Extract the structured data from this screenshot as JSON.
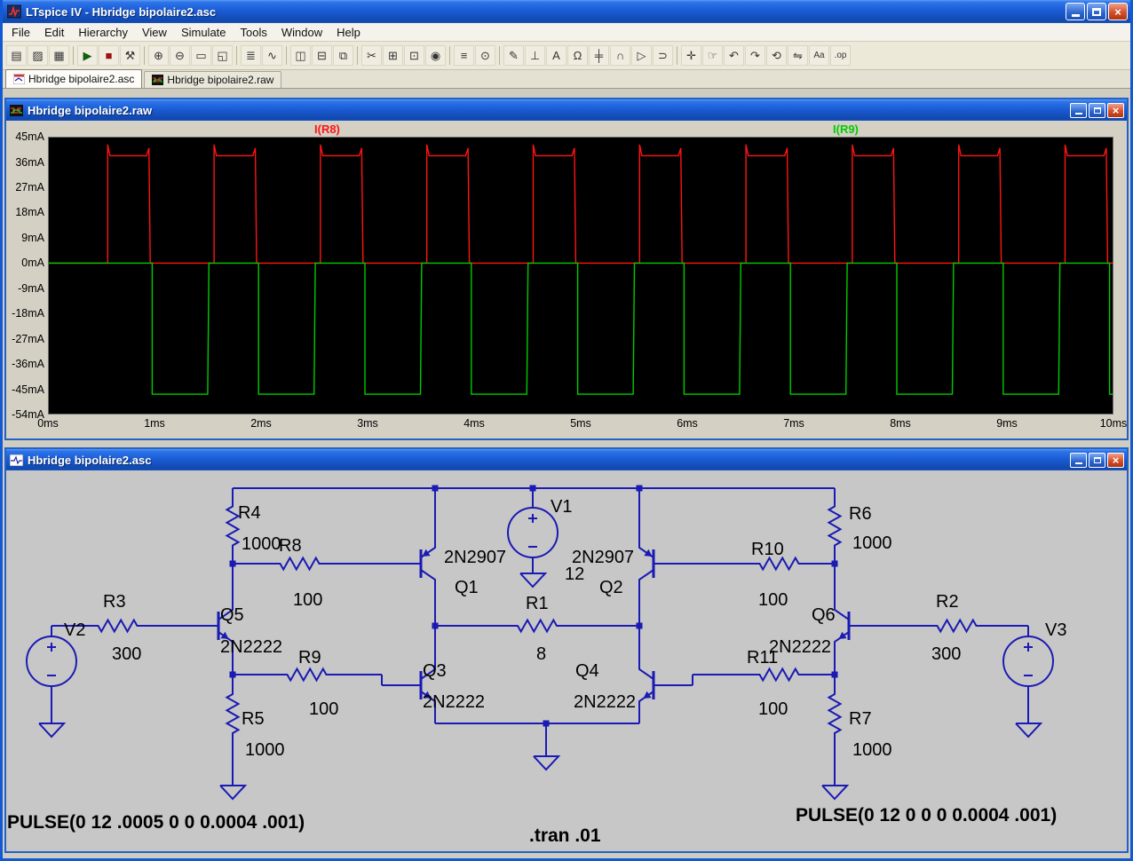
{
  "window": {
    "title": "LTspice IV - Hbridge bipolaire2.asc"
  },
  "menu": {
    "items": [
      "File",
      "Edit",
      "Hierarchy",
      "View",
      "Simulate",
      "Tools",
      "Window",
      "Help"
    ]
  },
  "toolbar": {
    "buttons": [
      {
        "name": "new-schematic",
        "glyph": "▤"
      },
      {
        "name": "open",
        "glyph": "▨"
      },
      {
        "name": "save",
        "glyph": "▦"
      },
      {
        "name": "sep"
      },
      {
        "name": "run",
        "glyph": "▶"
      },
      {
        "name": "halt",
        "glyph": "■"
      },
      {
        "name": "control-panel",
        "glyph": "⚒"
      },
      {
        "name": "sep"
      },
      {
        "name": "zoom-in",
        "glyph": "⊕"
      },
      {
        "name": "zoom-out",
        "glyph": "⊖"
      },
      {
        "name": "zoom-area",
        "glyph": "▭"
      },
      {
        "name": "zoom-extents",
        "glyph": "◱"
      },
      {
        "name": "sep"
      },
      {
        "name": "spice-netlist",
        "glyph": "≣"
      },
      {
        "name": "visible-traces",
        "glyph": "∿"
      },
      {
        "name": "sep"
      },
      {
        "name": "tile-vertical",
        "glyph": "◫"
      },
      {
        "name": "tile-horizontal",
        "glyph": "⊟"
      },
      {
        "name": "cascade",
        "glyph": "⧉"
      },
      {
        "name": "sep"
      },
      {
        "name": "cut",
        "glyph": "✂"
      },
      {
        "name": "copy",
        "glyph": "⊞"
      },
      {
        "name": "paste",
        "glyph": "⊡"
      },
      {
        "name": "find",
        "glyph": "◉"
      },
      {
        "name": "sep"
      },
      {
        "name": "print",
        "glyph": "≡"
      },
      {
        "name": "print-preview",
        "glyph": "⊙"
      },
      {
        "name": "sep"
      },
      {
        "name": "draw-wire",
        "glyph": "✎"
      },
      {
        "name": "place-ground",
        "glyph": "⊥"
      },
      {
        "name": "place-label",
        "glyph": "A"
      },
      {
        "name": "place-resistor",
        "glyph": "Ω"
      },
      {
        "name": "place-capacitor",
        "glyph": "╪"
      },
      {
        "name": "place-inductor",
        "glyph": "∩"
      },
      {
        "name": "place-diode",
        "glyph": "▷"
      },
      {
        "name": "place-component",
        "glyph": "⊃"
      },
      {
        "name": "sep"
      },
      {
        "name": "move",
        "glyph": "✛"
      },
      {
        "name": "drag",
        "glyph": "☞"
      },
      {
        "name": "undo",
        "glyph": "↶"
      },
      {
        "name": "redo",
        "glyph": "↷"
      },
      {
        "name": "rotate",
        "glyph": "⟲"
      },
      {
        "name": "mirror",
        "glyph": "⇋"
      },
      {
        "name": "text",
        "glyph": "Aa"
      },
      {
        "name": "spice-directive",
        "glyph": ".op"
      }
    ]
  },
  "tabs": [
    {
      "label": "Hbridge bipolaire2.asc",
      "active": true
    },
    {
      "label": "Hbridge bipolaire2.raw",
      "active": false
    }
  ],
  "waveform_window": {
    "title": "Hbridge bipolaire2.raw",
    "chart_data": {
      "type": "line",
      "title": "",
      "x_unit": "ms",
      "y_unit": "mA",
      "xlim_ms": [
        0,
        10
      ],
      "ylim_mA": [
        -54,
        45
      ],
      "grid": false,
      "background": "#000000",
      "legend_position": "top",
      "x_ticks": [
        "0ms",
        "1ms",
        "2ms",
        "3ms",
        "4ms",
        "5ms",
        "6ms",
        "7ms",
        "8ms",
        "9ms",
        "10ms"
      ],
      "y_ticks": [
        "45mA",
        "36mA",
        "27mA",
        "18mA",
        "9mA",
        "0mA",
        "-9mA",
        "-18mA",
        "-27mA",
        "-36mA",
        "-45mA",
        "-54mA"
      ],
      "series": [
        {
          "name": "I(R8)",
          "color": "#ff1414",
          "shape": "pulse-train",
          "baseline": 0,
          "level": 38.5,
          "overshoot": 42.5,
          "delay_ms": 0.553,
          "width_ms": 0.4,
          "period_ms": 1,
          "cycles": 10
        },
        {
          "name": "I(R9)",
          "color": "#00cc00",
          "shape": "pulse-train",
          "baseline": 0,
          "level": -47,
          "overshoot": -47,
          "delay_ms": 0.972,
          "width_ms": 0.533,
          "period_ms": 1,
          "cycles": 10
        }
      ]
    }
  },
  "schematic_window": {
    "title": "Hbridge bipolaire2.asc",
    "components": {
      "R1": {
        "label": "R1",
        "value": "8"
      },
      "R2": {
        "label": "R2",
        "value": "300"
      },
      "R3": {
        "label": "R3",
        "value": "300"
      },
      "R4": {
        "label": "R4",
        "value": "1000"
      },
      "R5": {
        "label": "R5",
        "value": "1000"
      },
      "R6": {
        "label": "R6",
        "value": "1000"
      },
      "R7": {
        "label": "R7",
        "value": "1000"
      },
      "R8": {
        "label": "R8",
        "value": "100"
      },
      "R9": {
        "label": "R9",
        "value": "100"
      },
      "R10": {
        "label": "R10",
        "value": "100"
      },
      "R11": {
        "label": "R11",
        "value": "100"
      },
      "Q1": {
        "label": "Q1",
        "value": "2N2907"
      },
      "Q2": {
        "label": "Q2",
        "value": "2N2907"
      },
      "Q3": {
        "label": "Q3",
        "value": "2N2222"
      },
      "Q4": {
        "label": "Q4",
        "value": "2N2222"
      },
      "Q5": {
        "label": "Q5",
        "value": "2N2222"
      },
      "Q6": {
        "label": "Q6",
        "value": "2N2222"
      },
      "V1": {
        "label": "V1",
        "value": "12"
      },
      "V2": {
        "label": "V2"
      },
      "V3": {
        "label": "V3"
      }
    },
    "directives": {
      "pulse_left": "PULSE(0 12 .0005 0 0 0.0004 .001)",
      "pulse_right": "PULSE(0 12 0 0 0 0.0004 .001)",
      "tran": ".tran .01"
    }
  }
}
